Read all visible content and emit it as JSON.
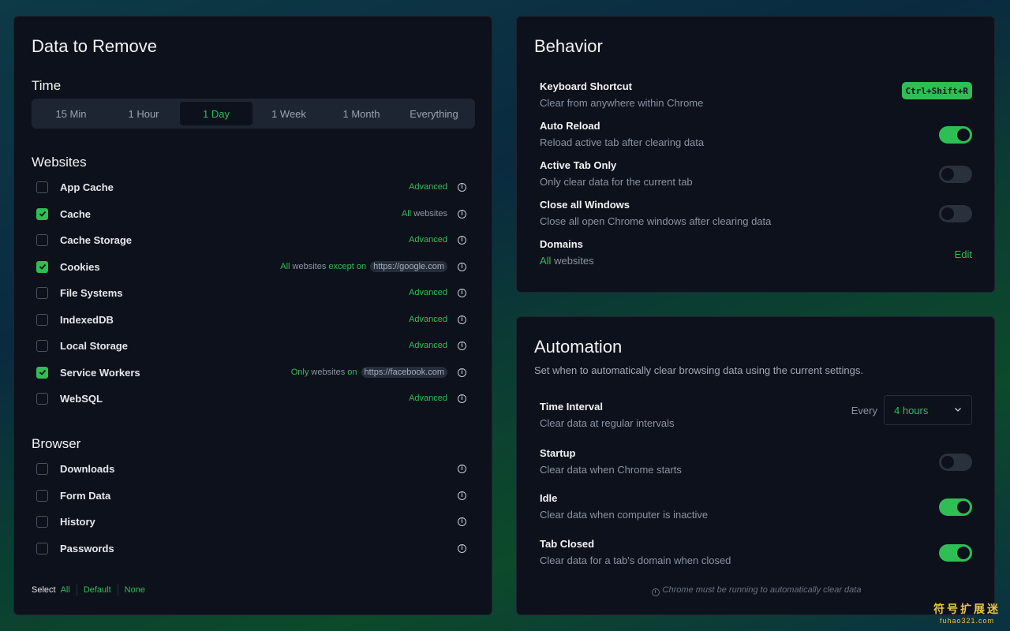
{
  "remove_panel": {
    "title": "Data to Remove",
    "time": {
      "title": "Time",
      "options": [
        "15 Min",
        "1 Hour",
        "1 Day",
        "1 Week",
        "1 Month",
        "Everything"
      ],
      "selected": "1 Day"
    },
    "websites": {
      "title": "Websites",
      "items": [
        {
          "label": "App Cache",
          "checked": false,
          "right": {
            "green_a": "Advanced"
          }
        },
        {
          "label": "Cache",
          "checked": true,
          "right": {
            "green_a": "All",
            "text_a": "websites"
          }
        },
        {
          "label": "Cache Storage",
          "checked": false,
          "right": {
            "green_a": "Advanced"
          }
        },
        {
          "label": "Cookies",
          "checked": true,
          "right": {
            "green_a": "All",
            "text_a": "websites",
            "green_b": "except on",
            "url": "https://google.com"
          }
        },
        {
          "label": "File Systems",
          "checked": false,
          "right": {
            "green_a": "Advanced"
          }
        },
        {
          "label": "IndexedDB",
          "checked": false,
          "right": {
            "green_a": "Advanced"
          }
        },
        {
          "label": "Local Storage",
          "checked": false,
          "right": {
            "green_a": "Advanced"
          }
        },
        {
          "label": "Service Workers",
          "checked": true,
          "right": {
            "green_a": "Only",
            "text_a": "websites",
            "green_b": "on",
            "url": "https://facebook.com"
          }
        },
        {
          "label": "WebSQL",
          "checked": false,
          "right": {
            "green_a": "Advanced"
          }
        }
      ]
    },
    "browser": {
      "title": "Browser",
      "items": [
        {
          "label": "Downloads",
          "checked": false
        },
        {
          "label": "Form Data",
          "checked": false
        },
        {
          "label": "History",
          "checked": false
        },
        {
          "label": "Passwords",
          "checked": false
        }
      ]
    },
    "select": {
      "label": "Select",
      "all": "All",
      "default": "Default",
      "none": "None"
    }
  },
  "behavior_panel": {
    "title": "Behavior",
    "keyboard_shortcut": {
      "title": "Keyboard Shortcut",
      "desc": "Clear from anywhere within Chrome",
      "key": "Ctrl+Shift+R"
    },
    "auto_reload": {
      "title": "Auto Reload",
      "desc": "Reload active tab after clearing data",
      "on": true
    },
    "active_tab_only": {
      "title": "Active Tab Only",
      "desc": "Only clear data for the current tab",
      "on": false
    },
    "close_all_windows": {
      "title": "Close all Windows",
      "desc": "Close all open Chrome windows after clearing data",
      "on": false
    },
    "domains": {
      "title": "Domains",
      "desc_green": "All",
      "desc_rest": "websites",
      "edit": "Edit"
    }
  },
  "automation_panel": {
    "title": "Automation",
    "subtitle": "Set when to automatically clear browsing data using the current settings.",
    "time_interval": {
      "title": "Time Interval",
      "desc": "Clear data at regular intervals",
      "every": "Every",
      "value": "4 hours"
    },
    "startup": {
      "title": "Startup",
      "desc": "Clear data when Chrome starts",
      "on": false
    },
    "idle": {
      "title": "Idle",
      "desc": "Clear data when computer is inactive",
      "on": true
    },
    "tab_closed": {
      "title": "Tab Closed",
      "desc": "Clear data for a tab's domain when closed",
      "on": true
    },
    "note": "Chrome must be running to automatically clear data"
  },
  "watermark": {
    "cn": "符号扩展迷",
    "en": "fuhao321.com"
  },
  "colors": {
    "accent": "#2fbe54",
    "panel": "#0d111b",
    "muted": "#8a93a2"
  }
}
